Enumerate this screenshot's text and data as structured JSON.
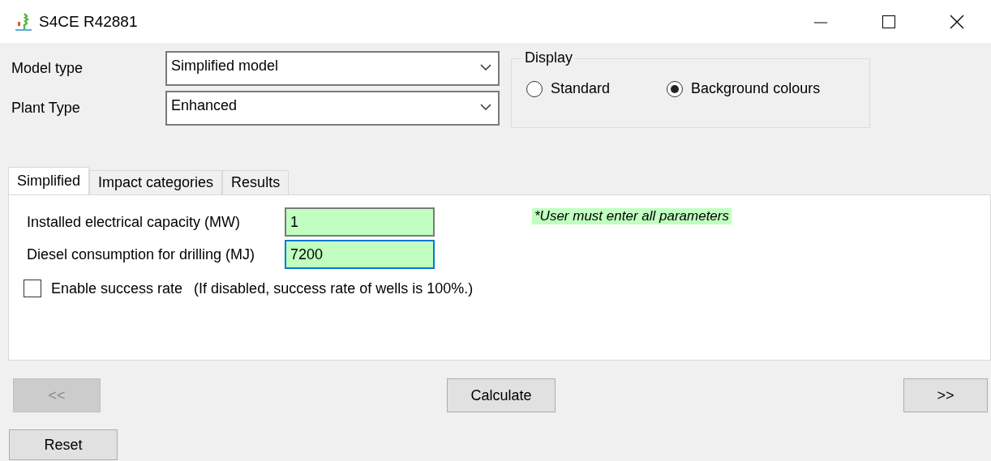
{
  "window": {
    "title": "S4CE R42881"
  },
  "selectors": [
    {
      "label": "Model type",
      "value": "Simplified model"
    },
    {
      "label": "Plant Type",
      "value": "Enhanced"
    }
  ],
  "display": {
    "title": "Display",
    "options": [
      {
        "label": "Standard",
        "selected": false
      },
      {
        "label": "Background colours",
        "selected": true
      }
    ]
  },
  "tabs": [
    {
      "label": "Simplified",
      "selected": true
    },
    {
      "label": "Impact categories",
      "selected": false
    },
    {
      "label": "Results",
      "selected": false
    }
  ],
  "fields": [
    {
      "label": "Installed electrical capacity (MW)",
      "value": "1",
      "focused": false
    },
    {
      "label": "Diesel consumption for drilling (MJ)",
      "value": "7200",
      "focused": true
    }
  ],
  "note": "*User must enter all parameters",
  "success_rate": {
    "label": "Enable success rate",
    "checked": false,
    "hint": "(If disabled, success rate of wells is 100%.)"
  },
  "nav": {
    "previous": {
      "label": "<<",
      "disabled": true
    },
    "calculate": {
      "label": "Calculate",
      "disabled": false
    },
    "next": {
      "label": ">>",
      "disabled": false
    }
  },
  "reset": {
    "label": "Reset"
  }
}
